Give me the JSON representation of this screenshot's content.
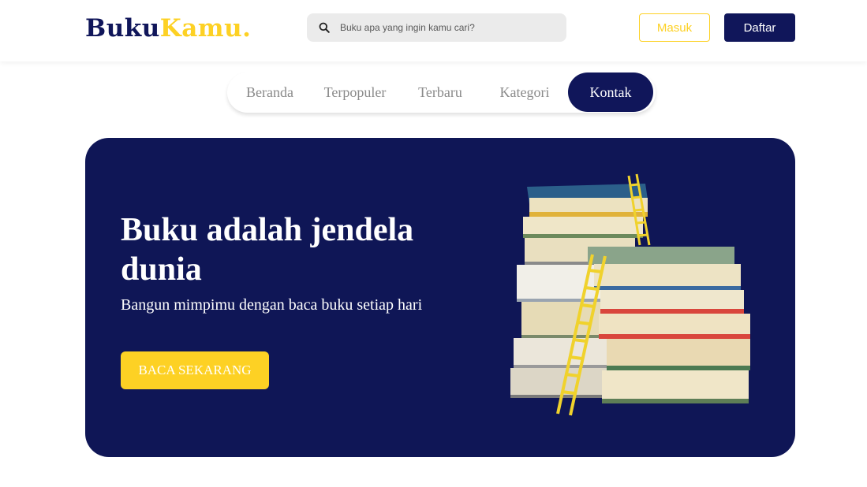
{
  "header": {
    "logo_part1": "Buku",
    "logo_part2": "Kamu",
    "logo_dot": ".",
    "search_placeholder": "Buku apa yang ingin kamu cari?",
    "login_label": "Masuk",
    "register_label": "Daftar"
  },
  "nav": {
    "items": [
      {
        "label": "Beranda"
      },
      {
        "label": "Terpopuler"
      },
      {
        "label": "Terbaru"
      },
      {
        "label": "Kategori"
      },
      {
        "label": "Kontak"
      }
    ],
    "active": "Kontak"
  },
  "hero": {
    "title": "Buku adalah jendela dunia",
    "subtitle": "Bangun mimpimu dengan baca buku setiap hari",
    "cta_label": "BACA SEKARANG"
  },
  "colors": {
    "brand_navy": "#10165a",
    "brand_yellow": "#fdd124",
    "hero_bg": "#0f1656"
  },
  "icons": {
    "search": "search-icon",
    "hero_image": "book-stack-with-ladder-illustration"
  }
}
